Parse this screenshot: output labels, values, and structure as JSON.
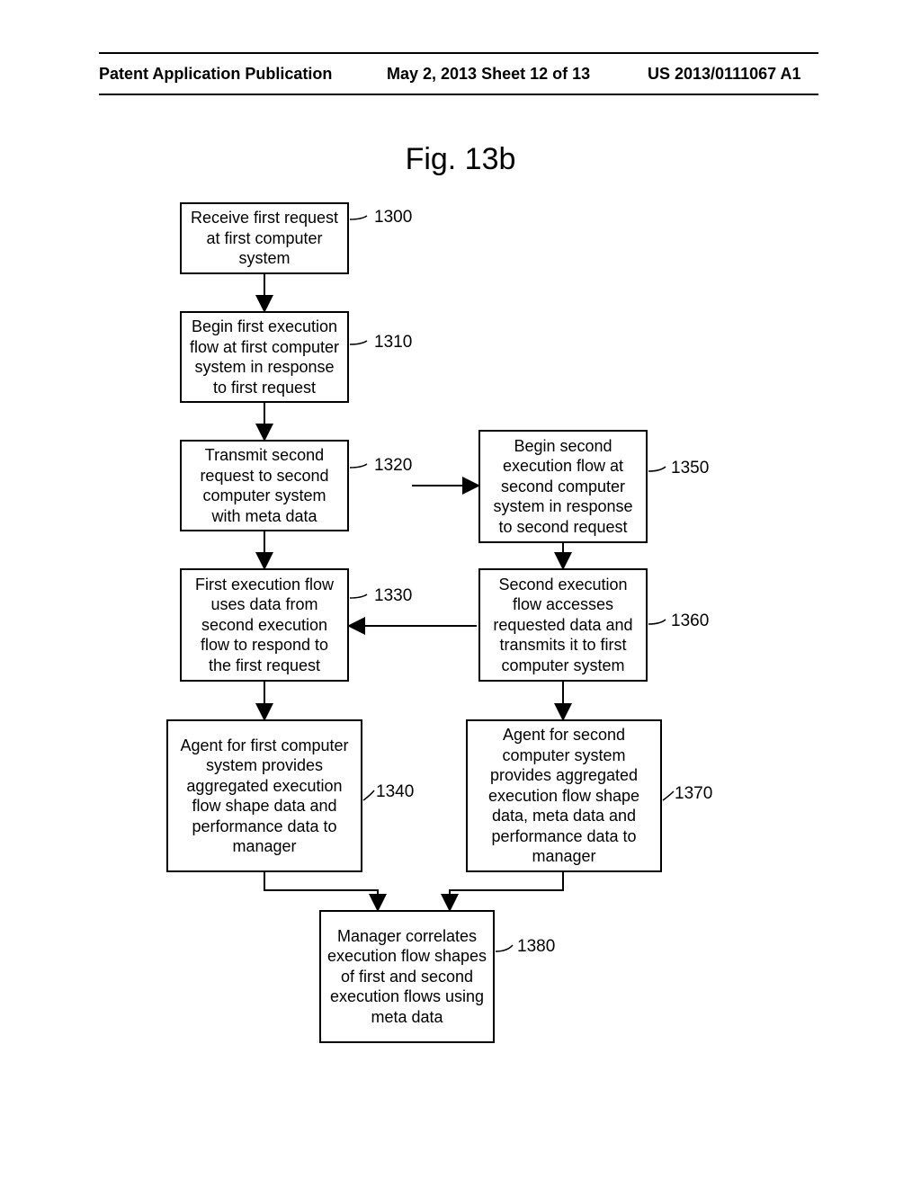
{
  "header": {
    "left": "Patent Application Publication",
    "mid": "May 2, 2013  Sheet 12 of 13",
    "right": "US 2013/0111067 A1"
  },
  "figure_title": "Fig. 13b",
  "boxes": {
    "b1300": "Receive first request at first computer system",
    "b1310": "Begin first execution flow at first computer system in response to first request",
    "b1320": "Transmit second request to second computer system with meta data",
    "b1330": "First execution flow uses data from second execution flow to respond to the first request",
    "b1340": "Agent for first computer system provides aggregated execution flow shape data and performance data to manager",
    "b1350": "Begin second execution flow at second computer system in response to second request",
    "b1360": "Second execution flow accesses requested data and transmits it to first computer system",
    "b1370": "Agent for second computer system provides aggregated execution flow shape data, meta data and performance data to manager",
    "b1380": "Manager correlates execution flow shapes of first and second execution flows using meta data"
  },
  "refs": {
    "r1300": "1300",
    "r1310": "1310",
    "r1320": "1320",
    "r1330": "1330",
    "r1340": "1340",
    "r1350": "1350",
    "r1360": "1360",
    "r1370": "1370",
    "r1380": "1380"
  }
}
